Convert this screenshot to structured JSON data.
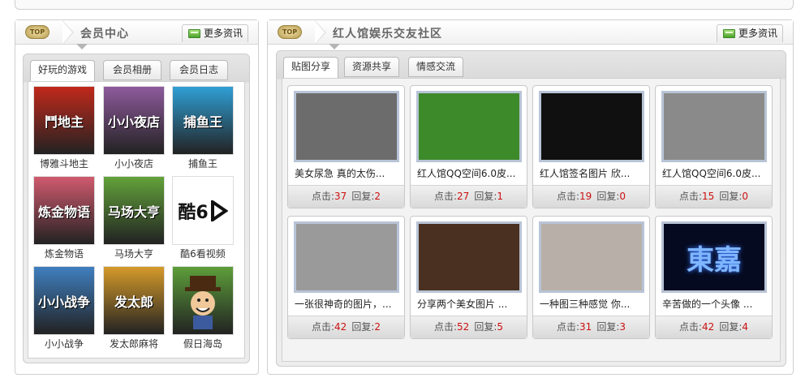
{
  "left_panel": {
    "badge": "TOP",
    "title": "会员中心",
    "more": "更多资讯",
    "tabs": [
      {
        "label": "好玩的游戏",
        "active": true
      },
      {
        "label": "会员相册",
        "active": false
      },
      {
        "label": "会员日志",
        "active": false
      }
    ],
    "games": [
      {
        "name": "博雅斗地主",
        "icon_text": "鬥地主",
        "color": "#c0291b"
      },
      {
        "name": "小小夜店",
        "icon_text": "小小夜店",
        "color": "#8e5a9c"
      },
      {
        "name": "捕鱼王",
        "icon_text": "捕鱼王",
        "color": "#2f9fd5"
      },
      {
        "name": "炼金物语",
        "icon_text": "炼金物语",
        "color": "#d05a6e"
      },
      {
        "name": "马场大亨",
        "icon_text": "马场大亨",
        "color": "#62a23a"
      },
      {
        "name": "酷6看视频",
        "icon_text": "酷6",
        "color": "#ffffff"
      },
      {
        "name": "小小战争",
        "icon_text": "小小战争",
        "color": "#3f7fbf"
      },
      {
        "name": "发太郎麻将",
        "icon_text": "发太郎",
        "color": "#d59a2a"
      },
      {
        "name": "假日海岛",
        "icon_text": "",
        "color": "#5d9e3a"
      }
    ]
  },
  "right_panel": {
    "badge": "TOP",
    "title": "红人馆娱乐交友社区",
    "more": "更多资讯",
    "tabs": [
      {
        "label": "贴图分享",
        "active": true
      },
      {
        "label": "资源共享",
        "active": false
      },
      {
        "label": "情感交流",
        "active": false
      }
    ],
    "stats_labels": {
      "clicks": "点击:",
      "replies": "回复:"
    },
    "cards": [
      {
        "title": "美女尿急 真的太伤...",
        "clicks": "37",
        "replies": "2",
        "bg": "#6c6c6c"
      },
      {
        "title": "红人馆QQ空间6.0皮...",
        "clicks": "27",
        "replies": "1",
        "bg": "#3d8a2b"
      },
      {
        "title": "红人馆签名图片 欣...",
        "clicks": "19",
        "replies": "0",
        "bg": "#101010"
      },
      {
        "title": "红人馆QQ空间6.0皮...",
        "clicks": "15",
        "replies": "0",
        "bg": "#8a8a8a"
      },
      {
        "title": "一张很神奇的图片，...",
        "clicks": "42",
        "replies": "2",
        "bg": "#9a9a9a"
      },
      {
        "title": "分享两个美女图片 ...",
        "clicks": "52",
        "replies": "5",
        "bg": "#4a3020"
      },
      {
        "title": "一种图三种感觉 你...",
        "clicks": "31",
        "replies": "3",
        "bg": "#b8b0a8"
      },
      {
        "title": "辛苦做的一个头像 ...",
        "clicks": "42",
        "replies": "4",
        "bg": "#050a20",
        "thumb_text": "東嘉"
      }
    ]
  }
}
